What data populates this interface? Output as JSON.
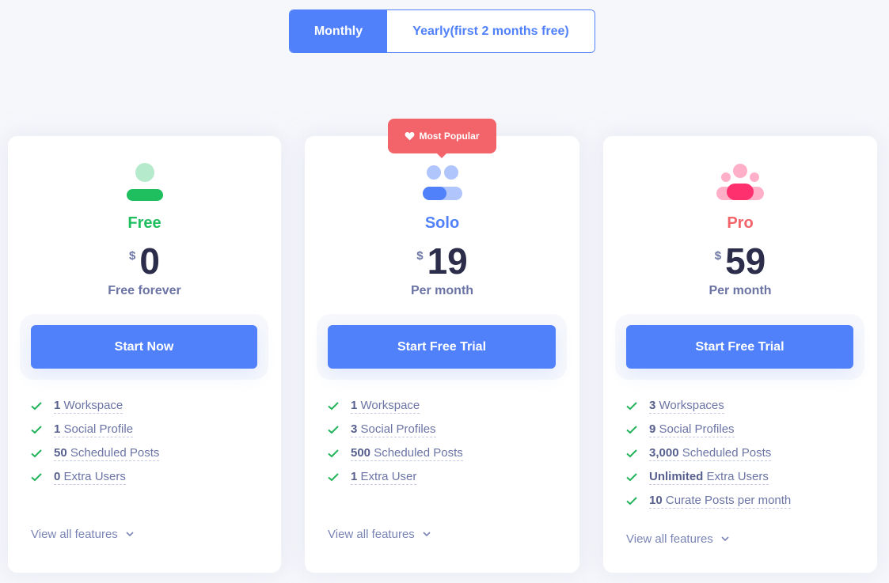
{
  "billing_toggle": {
    "monthly_label": "Monthly",
    "yearly_label": "Yearly(first 2 months free)",
    "selected": "Monthly"
  },
  "badge": {
    "label": "Most Popular",
    "icon": "heart-icon"
  },
  "colors": {
    "accent": "#5081fb",
    "free": "#1fbf5f",
    "solo": "#5081fb",
    "pro": "#f2636a",
    "badge": "#f2636a",
    "check": "#22b45a"
  },
  "plans": [
    {
      "name": "Free",
      "icon": "single-user-icon",
      "currency": "$",
      "price": "0",
      "period": "Free forever",
      "cta": "Start Now",
      "features": [
        {
          "num": "1",
          "text": "Workspace"
        },
        {
          "num": "1",
          "text": "Social Profile"
        },
        {
          "num": "50",
          "text": "Scheduled Posts"
        },
        {
          "num": "0",
          "text": "Extra Users"
        }
      ],
      "view_all": "View all features"
    },
    {
      "name": "Solo",
      "icon": "two-users-icon",
      "currency": "$",
      "price": "19",
      "period": "Per month",
      "cta": "Start Free Trial",
      "features": [
        {
          "num": "1",
          "text": "Workspace"
        },
        {
          "num": "3",
          "text": "Social Profiles"
        },
        {
          "num": "500",
          "text": "Scheduled Posts"
        },
        {
          "num": "1",
          "text": "Extra User"
        }
      ],
      "view_all": "View all features"
    },
    {
      "name": "Pro",
      "icon": "team-icon",
      "currency": "$",
      "price": "59",
      "period": "Per month",
      "cta": "Start Free Trial",
      "features": [
        {
          "num": "3",
          "text": "Workspaces"
        },
        {
          "num": "9",
          "text": "Social Profiles"
        },
        {
          "num": "3,000",
          "text": "Scheduled Posts"
        },
        {
          "num": "Unlimited",
          "text": "Extra Users"
        },
        {
          "num": "10",
          "text": "Curate Posts per month"
        }
      ],
      "view_all": "View all features"
    }
  ]
}
